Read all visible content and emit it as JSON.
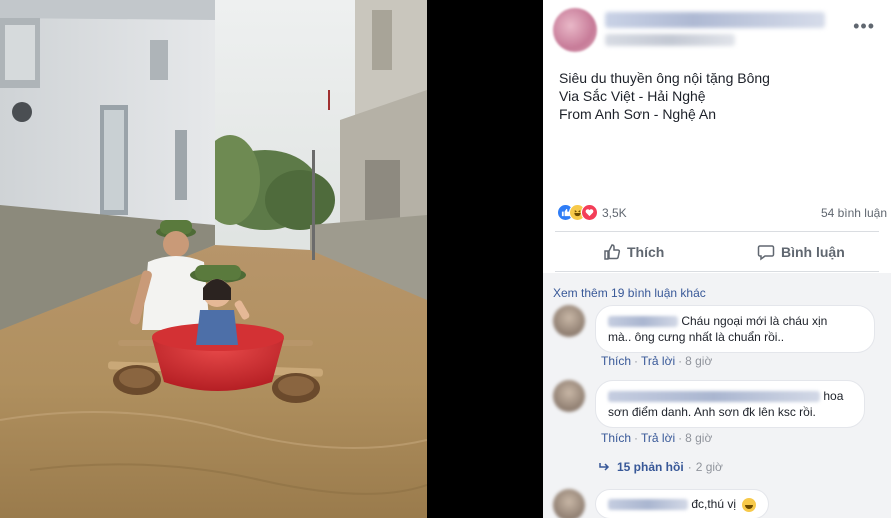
{
  "post": {
    "caption_lines": [
      "Siêu du thuyền ông nội tặng Bông",
      "Via Sắc Việt - Hải Nghệ",
      "From Anh Sơn - Nghệ An"
    ],
    "reaction_count": "3,5K",
    "comment_count": "54 bình luận",
    "reaction_icons": [
      "like-reaction",
      "haha-reaction",
      "love-reaction"
    ],
    "actions": {
      "like_label": "Thích",
      "comment_label": "Bình luận"
    }
  },
  "comments_section": {
    "view_more": "Xem thêm 19 bình luận khác",
    "comments": [
      {
        "text_line1": "Cháu ngoại mới là cháu xịn",
        "text_line2": "mà.. ông cưng nhất là chuẩn rồi..",
        "like": "Thích",
        "reply": "Trả lời",
        "time": "8 giờ"
      },
      {
        "text_line1": "hoa",
        "text_line2": "sơn điểm danh. Anh sơn đk lên ksc rồi.",
        "like": "Thích",
        "reply": "Trả lời",
        "time": "8 giờ"
      },
      {
        "text_line1": "đc,thú vị"
      }
    ],
    "replies_label": "15 phản hồi",
    "replies_time": "2 giờ"
  },
  "colors": {
    "link": "#385898",
    "like_blue": "#2f7df6",
    "love_red": "#f33e58",
    "haha_yellow": "#f7c94a",
    "muted_text": "#606770",
    "comments_bg": "#f2f3f5"
  }
}
